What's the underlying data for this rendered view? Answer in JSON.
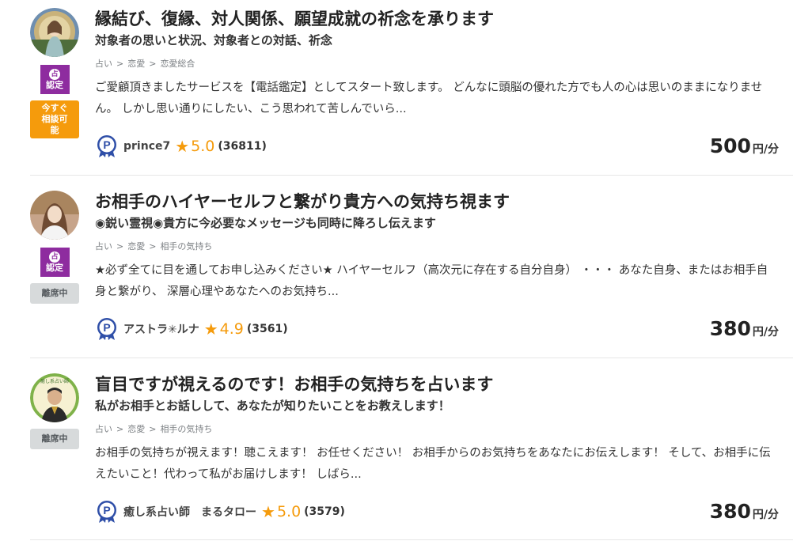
{
  "listings": [
    {
      "title": "縁結び、復縁、対人関係、願望成就の祈念を承ります",
      "subtitle": "対象者の思いと状況、対象者との対話、祈念",
      "breadcrumb": [
        "占い",
        "恋愛",
        "恋愛総合"
      ],
      "description": "ご愛顧頂きましたサービスを【電話鑑定】としてスタート致します。 どんなに頭脳の優れた方でも人の心は思いのままになりません。 しかし思い通りにしたい、こう思われて苦しんでいら...",
      "certified": true,
      "certified_label": "認定",
      "certified_mark": "占",
      "status": "今すぐ相談可能",
      "status_type": "available",
      "author": "prince7",
      "rating": "5.0",
      "review_count": "(36811)",
      "price": "500",
      "price_unit": "円/分"
    },
    {
      "title": "お相手のハイヤーセルフと繋がり貴方への気持ち視ます",
      "subtitle": "◉鋭い霊視◉貴方に今必要なメッセージも同時に降ろし伝えます",
      "breadcrumb": [
        "占い",
        "恋愛",
        "相手の気持ち"
      ],
      "description": "★必ず全てに目を通してお申し込みください★ ハイヤーセルフ（高次元に存在する自分自身） ・・・ あなた自身、またはお相手自身と繋がり、 深層心理やあなたへのお気持ち...",
      "certified": true,
      "certified_label": "認定",
      "certified_mark": "占",
      "status": "離席中",
      "status_type": "away",
      "author": "アストラ✳ルナ",
      "rating": "4.9",
      "review_count": "(3561)",
      "price": "380",
      "price_unit": "円/分"
    },
    {
      "title": "盲目ですが視えるのです！お相手の気持ちを占います",
      "subtitle": "私がお相手とお話しして、あなたが知りたいことをお教えします！",
      "breadcrumb": [
        "占い",
        "恋愛",
        "相手の気持ち"
      ],
      "description": "お相手の気持ちが視えます！聴こえます！ お任せください！ お相手からのお気持ちをあなたにお伝えします！ そして、お相手に伝えたいこと！代わって私がお届けします！ しばら...",
      "certified": false,
      "status": "離席中",
      "status_type": "away",
      "author": "癒し系占い師　まるタロー",
      "rating": "5.0",
      "review_count": "(3579)",
      "price": "380",
      "price_unit": "円/分",
      "avatar_text": "癒し系占い師"
    }
  ],
  "colors": {
    "accent_orange": "#f59b0c",
    "cert_purple": "#8e2c9f",
    "away_gray": "#d7dadb",
    "p_icon_blue": "#2f4fa8"
  }
}
